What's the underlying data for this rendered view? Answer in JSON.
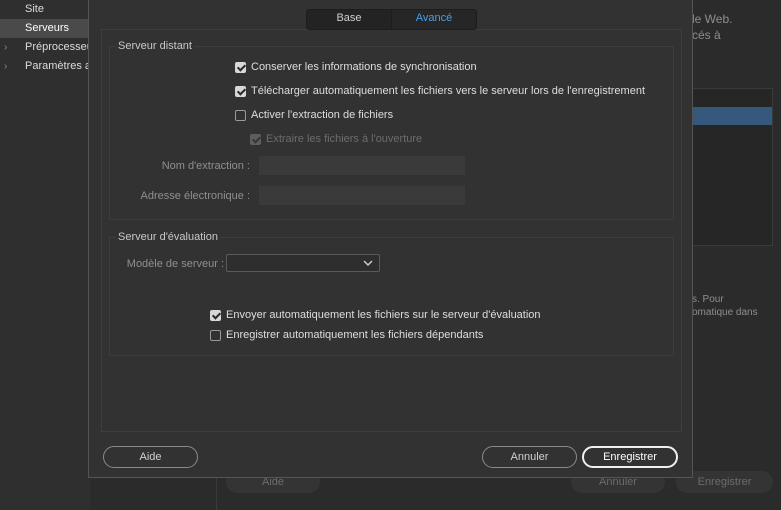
{
  "background": {
    "sidebar": [
      {
        "label": "Site",
        "selected": false,
        "expandable": false
      },
      {
        "label": "Serveurs",
        "selected": true,
        "expandable": false
      },
      {
        "label": "Préprocesseurs CSS",
        "selected": false,
        "expandable": true
      },
      {
        "label": "Paramètres avancés",
        "selected": false,
        "expandable": true
      }
    ],
    "right_text_1": "le Web.",
    "right_text_2": "cés à",
    "right_text_3": "s. Pour",
    "right_text_4": "omatique dans",
    "help_button": "Aide",
    "cancel_button": "Annuler",
    "save_button": "Enregistrer"
  },
  "dialog": {
    "tabs": [
      {
        "label": "Base",
        "active": false
      },
      {
        "label": "Avancé",
        "active": true
      }
    ],
    "remote_server": {
      "legend": "Serveur distant",
      "checks": [
        {
          "label": "Conserver les informations de synchronisation",
          "checked": true,
          "disabled": false
        },
        {
          "label": "Télécharger automatiquement les fichiers vers le serveur lors de l'enregistrement",
          "checked": true,
          "disabled": false
        },
        {
          "label": "Activer l'extraction de fichiers",
          "checked": false,
          "disabled": false
        },
        {
          "label": "Extraire les fichiers à l'ouverture",
          "checked": true,
          "disabled": true
        }
      ],
      "checkout_name_label": "Nom d'extraction :",
      "checkout_name_value": "",
      "email_label": "Adresse électronique :",
      "email_value": ""
    },
    "testing_server": {
      "legend": "Serveur d'évaluation",
      "model_label": "Modèle de serveur :",
      "model_value": "",
      "checks": [
        {
          "label": "Envoyer automatiquement les fichiers sur le serveur d'évaluation",
          "checked": true,
          "disabled": false
        },
        {
          "label": "Enregistrer automatiquement les fichiers dépendants",
          "checked": false,
          "disabled": false
        }
      ]
    },
    "help_button": "Aide",
    "cancel_button": "Annuler",
    "save_button": "Enregistrer"
  }
}
